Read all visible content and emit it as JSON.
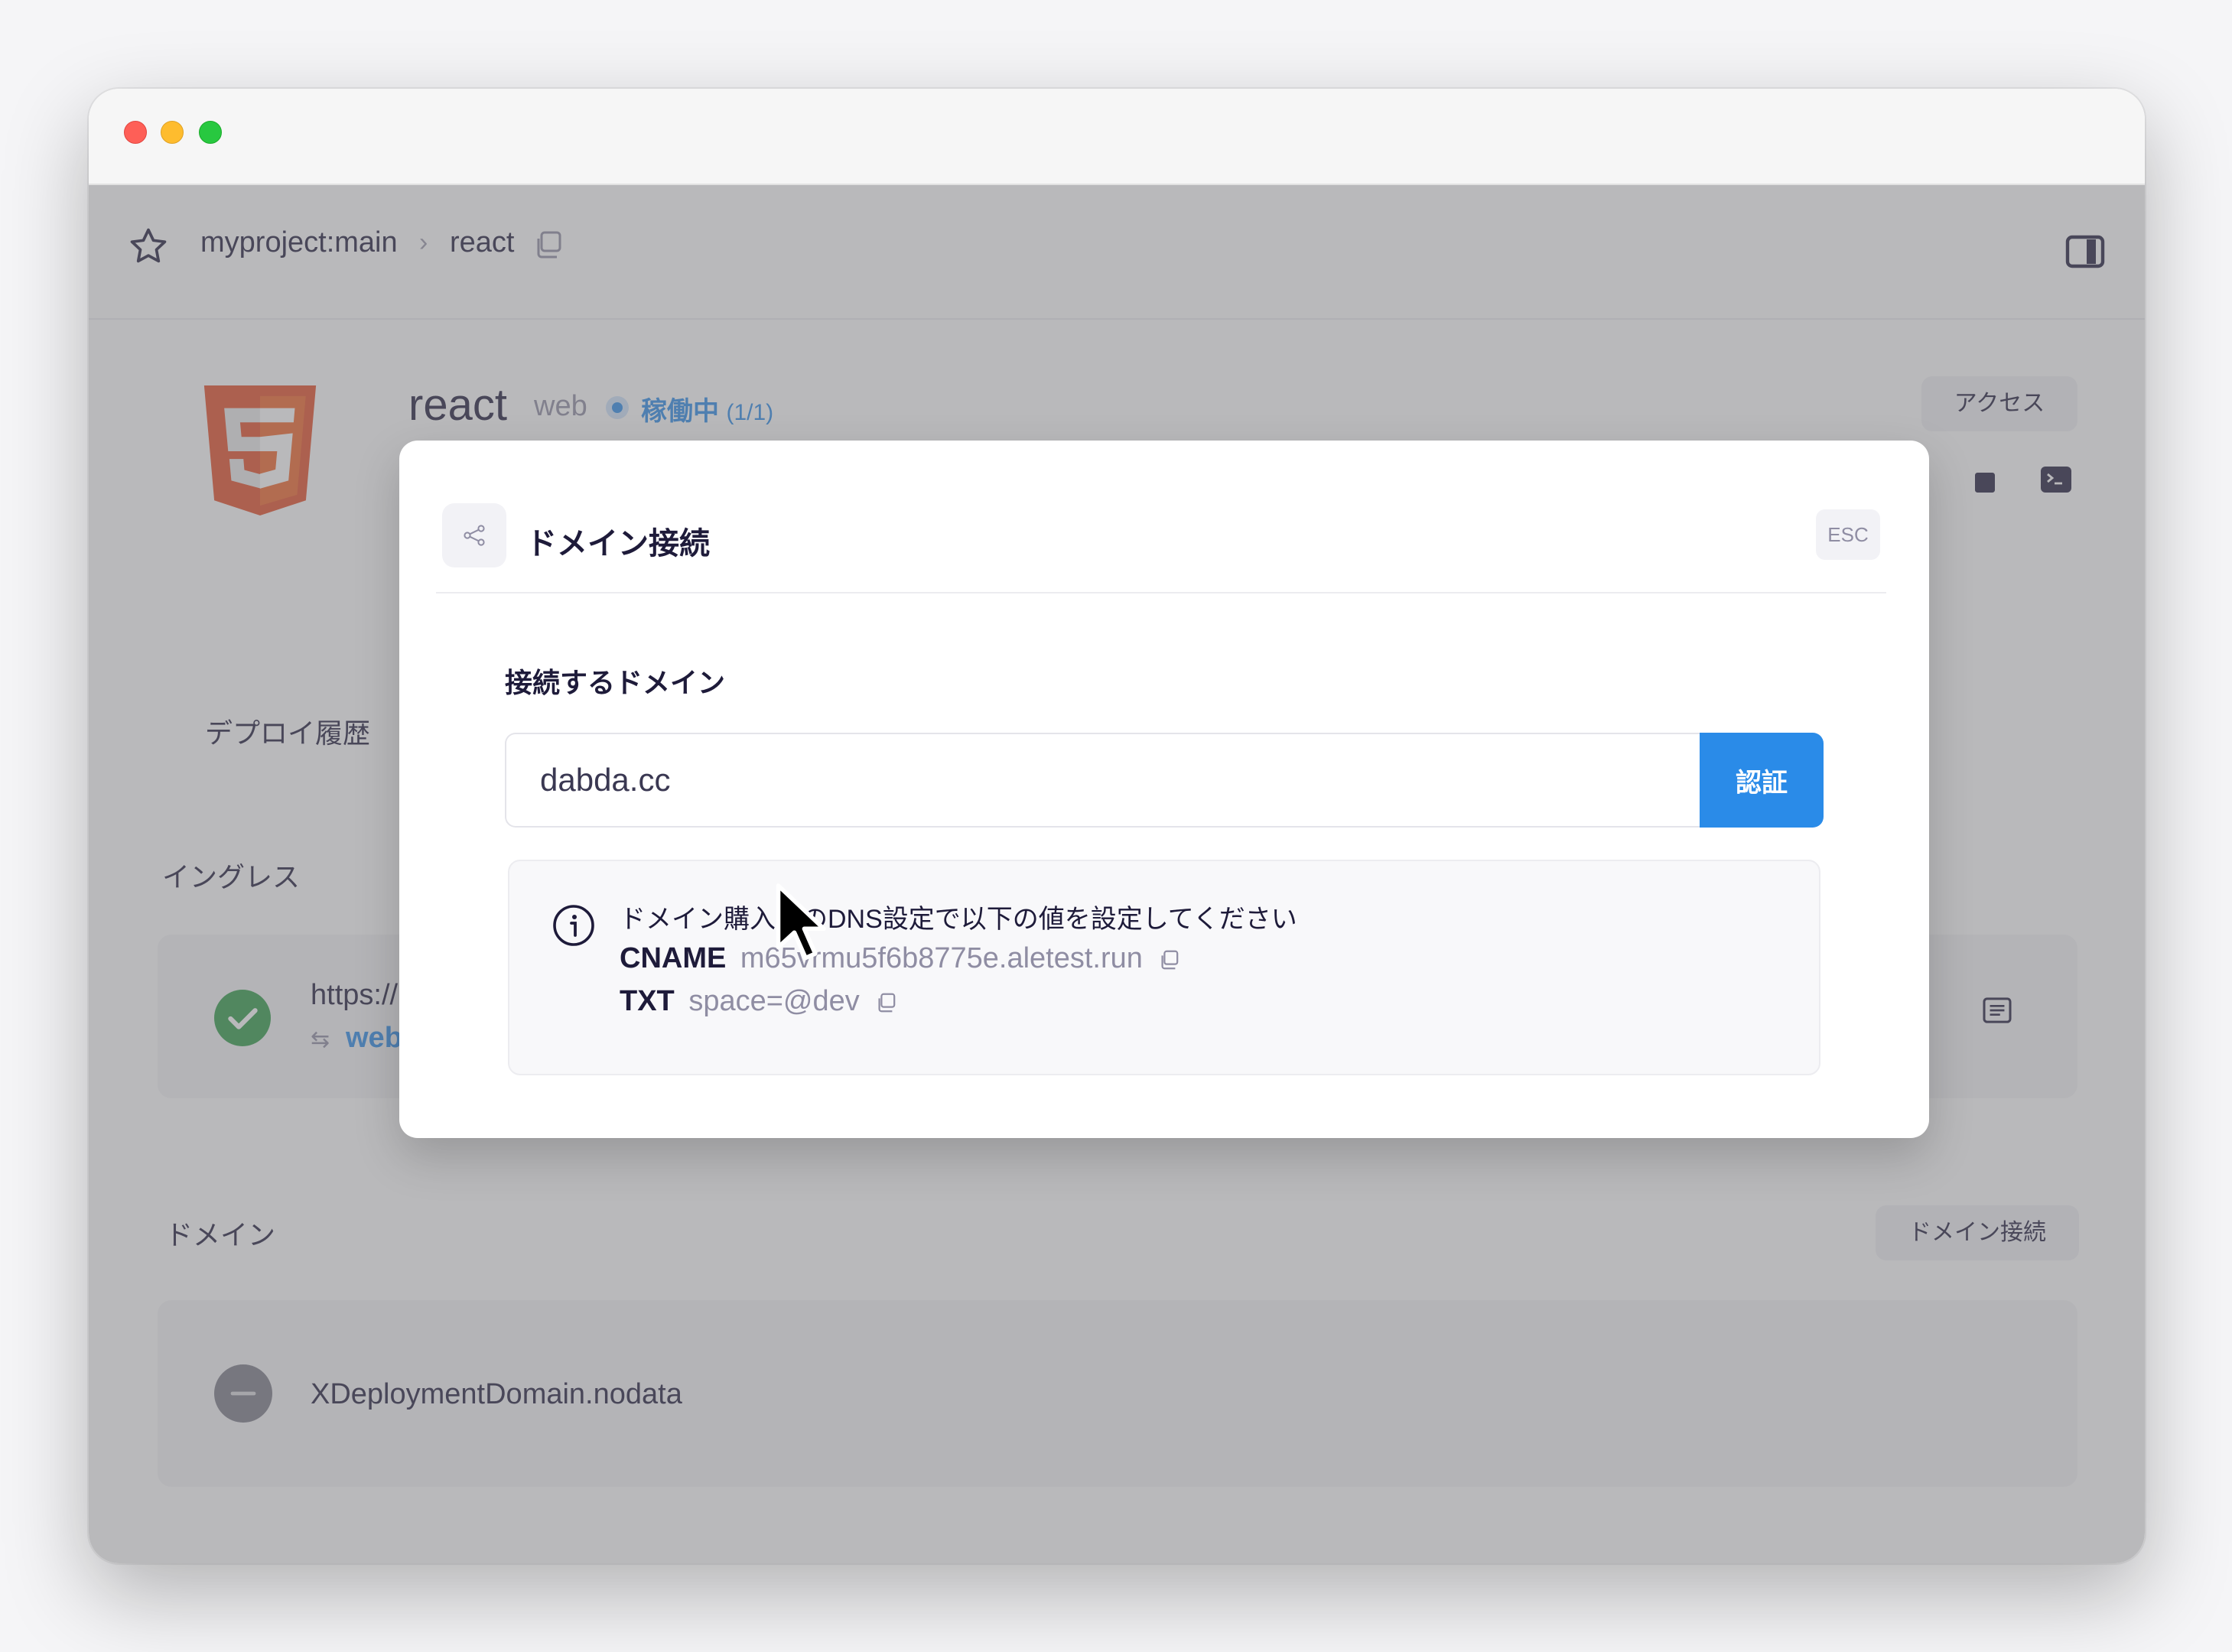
{
  "breadcrumb": {
    "project": "myproject:main",
    "separator": "›",
    "current": "react"
  },
  "service": {
    "name": "react",
    "type": "web",
    "status": "稼働中",
    "status_count": "(1/1)",
    "access_label": "アクセス"
  },
  "sections": {
    "deploy_history": "デプロイ履歴",
    "ingress": "イングレス",
    "domain": "ドメイン"
  },
  "ingress": {
    "url": "https://",
    "target": "web"
  },
  "domain": {
    "connect_button": "ドメイン接続",
    "item_name": "XDeploymentDomain.nodata"
  },
  "modal": {
    "title": "ドメイン接続",
    "esc_label": "ESC",
    "field_label": "接続するドメイン",
    "input_value": "dabda.cc",
    "verify_label": "認証",
    "info_text": "ドメイン購入先のDNS設定で以下の値を設定してください",
    "cname_key": "CNAME",
    "cname_value": "m65vrmu5f6b8775e.aletest.run",
    "txt_key": "TXT",
    "txt_value": "space=@dev"
  },
  "colors": {
    "accent": "#2a8be8",
    "success": "#2e9b46",
    "overlay": "#737378"
  },
  "icons": [
    "star-icon",
    "copy-icon",
    "panel-toggle-icon",
    "html5-logo",
    "stop-icon",
    "terminal-icon",
    "check-icon",
    "log-icon",
    "minus-icon",
    "share-icon",
    "info-icon",
    "cursor-icon"
  ]
}
